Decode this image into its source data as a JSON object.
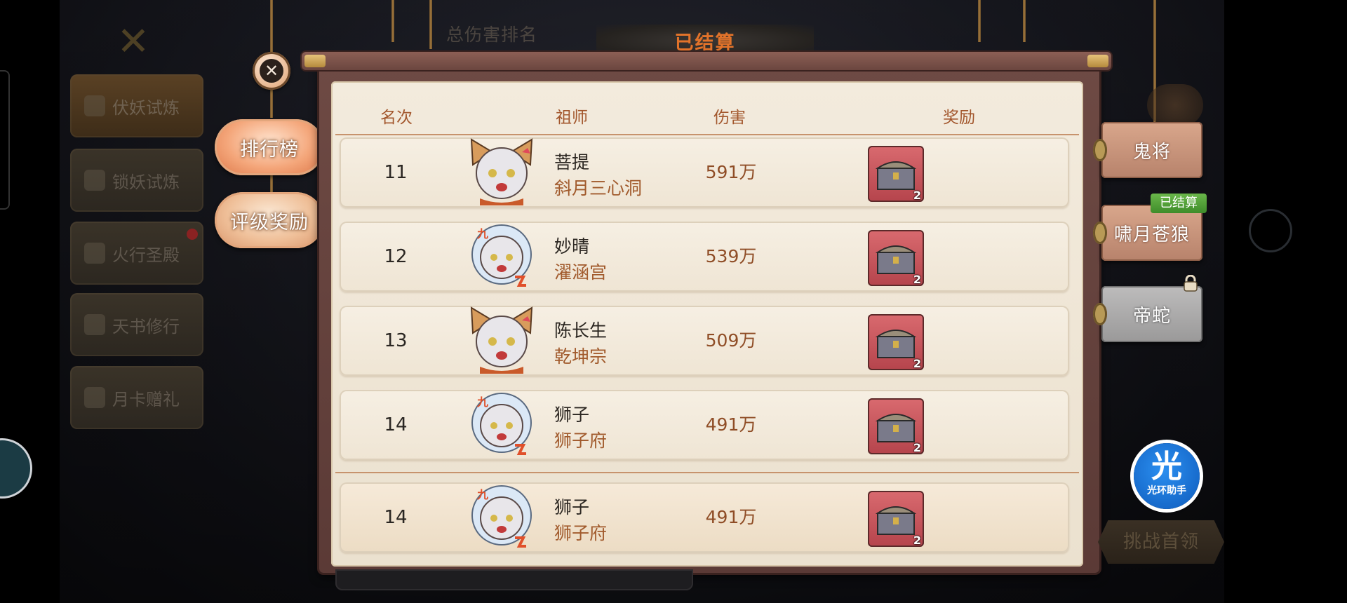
{
  "top": {
    "rank_label": "总伤害排名",
    "banner": "已结算"
  },
  "left_menu": {
    "items": [
      {
        "label": "伏妖试炼"
      },
      {
        "label": "锁妖试炼"
      },
      {
        "label": "火行圣殿"
      },
      {
        "label": "天书修行"
      },
      {
        "label": "月卡赠礼"
      }
    ]
  },
  "side_buttons": {
    "leaderboard": "排行榜",
    "rating_rewards": "评级奖励"
  },
  "table": {
    "columns": [
      "名次",
      "祖师",
      "伤害",
      "奖励"
    ],
    "rows": [
      {
        "rank": "11",
        "name": "菩提",
        "sect": "斜月三心洞",
        "damage": "591万",
        "reward_count": "2",
        "avatar": "fox-girl-avatar"
      },
      {
        "rank": "12",
        "name": "妙晴",
        "sect": "濯涵宫",
        "damage": "539万",
        "reward_count": "2",
        "avatar": "badge-girl-avatar"
      },
      {
        "rank": "13",
        "name": "陈长生",
        "sect": "乾坤宗",
        "damage": "509万",
        "reward_count": "2",
        "avatar": "fox-girl-avatar"
      },
      {
        "rank": "14",
        "name": "狮子",
        "sect": "狮子府",
        "damage": "491万",
        "reward_count": "2",
        "avatar": "badge-girl-avatar"
      }
    ],
    "my_row": {
      "rank": "14",
      "name": "狮子",
      "sect": "狮子府",
      "damage": "491万",
      "reward_count": "2",
      "avatar": "badge-girl-avatar"
    }
  },
  "bosses": [
    {
      "label": "鬼将",
      "state": "active"
    },
    {
      "label": "啸月苍狼",
      "badge": "已结算"
    },
    {
      "label": "帝蛇",
      "locked": true
    }
  ],
  "assist": {
    "glyph": "光",
    "label": "光环助手"
  },
  "challenge_button": "挑战首领",
  "colors": {
    "accent_orange": "#e2732a",
    "damage_brown": "#8f4d26",
    "sect_brown": "#a15a2c",
    "settled_green": "#3e8c2a"
  }
}
